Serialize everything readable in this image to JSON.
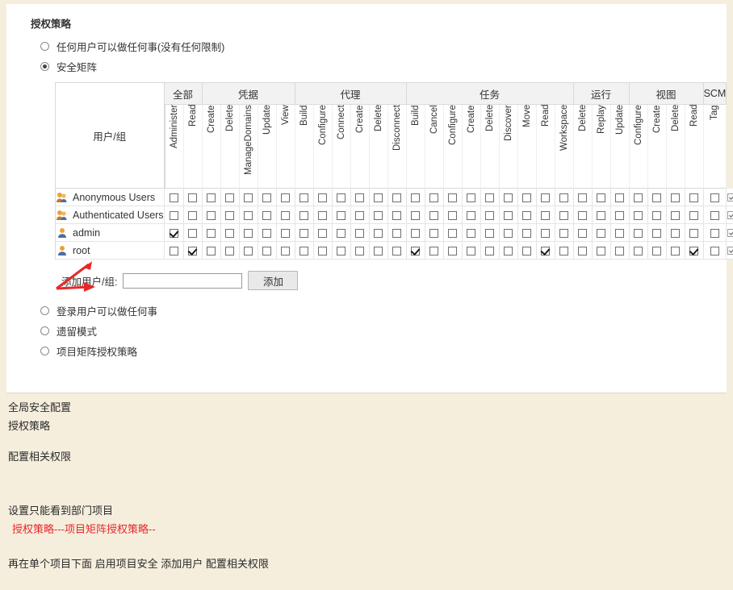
{
  "panel": {
    "section_title": "授权策略",
    "top_options": [
      {
        "label": "任何用户可以做任何事(没有任何限制)",
        "selected": false
      },
      {
        "label": "安全矩阵",
        "selected": true
      }
    ],
    "bottom_options": [
      {
        "label": "登录用户可以做任何事",
        "selected": false
      },
      {
        "label": "遗留模式",
        "selected": false
      },
      {
        "label": "项目矩阵授权策略",
        "selected": false
      }
    ],
    "add_user": {
      "label": "添加用户/组:",
      "value": "",
      "placeholder": "",
      "button_label": "添加"
    }
  },
  "matrix": {
    "user_column_header": "用户/组",
    "groups": [
      {
        "name": "全部",
        "span": 2
      },
      {
        "name": "凭据",
        "span": 5
      },
      {
        "name": "代理",
        "span": 6
      },
      {
        "name": "任务",
        "span": 9
      },
      {
        "name": "运行",
        "span": 3
      },
      {
        "name": "视图",
        "span": 4
      },
      {
        "name": "SCM",
        "span": 1
      }
    ],
    "columns": [
      "Administer",
      "Read",
      "Create",
      "Delete",
      "ManageDomains",
      "Update",
      "View",
      "Build",
      "Configure",
      "Connect",
      "Create",
      "Delete",
      "Disconnect",
      "Build",
      "Cancel",
      "Configure",
      "Create",
      "Delete",
      "Discover",
      "Move",
      "Read",
      "Workspace",
      "Delete",
      "Replay",
      "Update",
      "Configure",
      "Create",
      "Delete",
      "Read",
      "Tag"
    ],
    "rows": [
      {
        "name": "Anonymous Users",
        "icon": "group-user-icon",
        "checked": [],
        "actions": [
          "select-all-icon",
          "copy-icon"
        ]
      },
      {
        "name": "Authenticated Users",
        "icon": "group-user-icon",
        "checked": [],
        "actions": [
          "select-all-icon",
          "copy-icon"
        ]
      },
      {
        "name": "admin",
        "icon": "single-user-icon",
        "checked": [
          1
        ],
        "actions": [
          "select-all-icon",
          "copy-icon",
          "delete-icon"
        ]
      },
      {
        "name": "root",
        "icon": "single-user-icon",
        "checked": [
          2,
          14,
          21,
          29
        ],
        "actions": [
          "select-all-icon",
          "copy-icon",
          "delete-icon"
        ]
      }
    ]
  },
  "notes": [
    {
      "text": "全局安全配置",
      "red": false
    },
    {
      "text": "授权策略",
      "red": false
    },
    {
      "text": "配置相关权限",
      "red": false
    },
    {
      "text": "设置只能看到部门项目",
      "red": false
    },
    {
      "text": "授权策略---项目矩阵授权策略--",
      "red": true
    },
    {
      "text": "再在单个项目下面 启用项目安全  添加用户   配置相关权限",
      "red": false
    }
  ],
  "colors": {
    "page_bg": "#f5eedd",
    "panel_bg": "#ffffff",
    "accent_red": "#e8282a",
    "header_bg": "#f2f2f2"
  }
}
